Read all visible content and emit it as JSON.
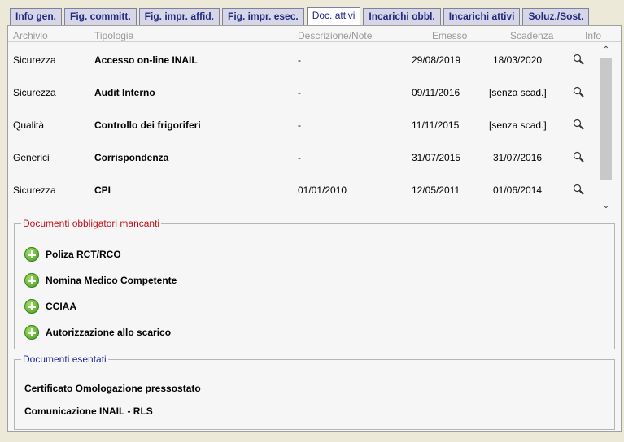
{
  "tabs": [
    "Info gen.",
    "Fig. committ.",
    "Fig. impr. affid.",
    "Fig. impr. esec.",
    "Doc. attivi",
    "Incarichi obbl.",
    "Incarichi attivi",
    "Soluz./Sost."
  ],
  "active_tab": "Doc. attivi",
  "table": {
    "headers": {
      "archivio": "Archivio",
      "tipologia": "Tipologia",
      "descrizione": "Descrizione/Note",
      "emesso": "Emesso",
      "scadenza": "Scadenza",
      "info": "Info"
    },
    "rows": [
      {
        "archivio": "Sicurezza",
        "tipologia": "Accesso on-line INAIL",
        "descrizione": "-",
        "emesso": "29/08/2019",
        "scadenza": "18/03/2020",
        "info_icon": "magnifier-icon"
      },
      {
        "archivio": "Sicurezza",
        "tipologia": "Audit Interno",
        "descrizione": "-",
        "emesso": "09/11/2016",
        "scadenza": "[senza scad.]",
        "info_icon": "magnifier-icon"
      },
      {
        "archivio": "Qualità",
        "tipologia": "Controllo dei frigoriferi",
        "descrizione": "-",
        "emesso": "11/11/2015",
        "scadenza": "[senza scad.]",
        "info_icon": "magnifier-icon"
      },
      {
        "archivio": "Generici",
        "tipologia": "Corrispondenza",
        "descrizione": "-",
        "emesso": "31/07/2015",
        "scadenza": "31/07/2016",
        "info_icon": "magnifier-icon"
      },
      {
        "archivio": "Sicurezza",
        "tipologia": "CPI",
        "descrizione": "01/01/2010",
        "emesso": "12/05/2011",
        "scadenza": "01/06/2014",
        "info_icon": "magnifier-icon"
      }
    ]
  },
  "missing": {
    "legend": "Documenti obbligatori mancanti",
    "legend_color": "#c0101a",
    "items": [
      "Poliza RCT/RCO",
      "Nomina Medico Competente",
      "CCIAA",
      "Autorizzazione allo scarico"
    ]
  },
  "exempt": {
    "legend": "Documenti esentati",
    "legend_color": "#1b2a9c",
    "items": [
      "Certificato Omologazione pressostato",
      "Comunicazione INAIL - RLS"
    ]
  }
}
